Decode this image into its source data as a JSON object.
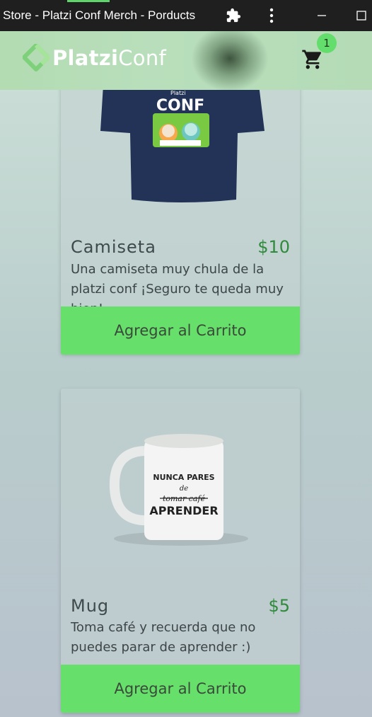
{
  "window": {
    "title": "Store - Platzi Conf Merch - Porducts",
    "icons": [
      "puzzle-extension-icon",
      "more-vertical-icon",
      "minimize-icon",
      "maximize-icon"
    ]
  },
  "header": {
    "logo_bold": "Platzi",
    "logo_light": "Conf",
    "cart_count": "1",
    "colors": {
      "accent": "#63dd6b",
      "header_bg": "#b5dcb5"
    }
  },
  "products": [
    {
      "name": "Camiseta",
      "price": "$10",
      "description": "Una camiseta muy chula de la platzi conf ¡Seguro te queda muy bien!",
      "button_label": "Agregar al Carrito",
      "image_text": "CONF",
      "image_brand": "Platzi"
    },
    {
      "name": "Mug",
      "price": "$5",
      "description": "Toma café y recuerda que no puedes parar de aprender :)",
      "button_label": "Agregar al Carrito",
      "image_lines": [
        "NUNCA PARES",
        "de",
        "tomar café",
        "APRENDER"
      ]
    }
  ]
}
